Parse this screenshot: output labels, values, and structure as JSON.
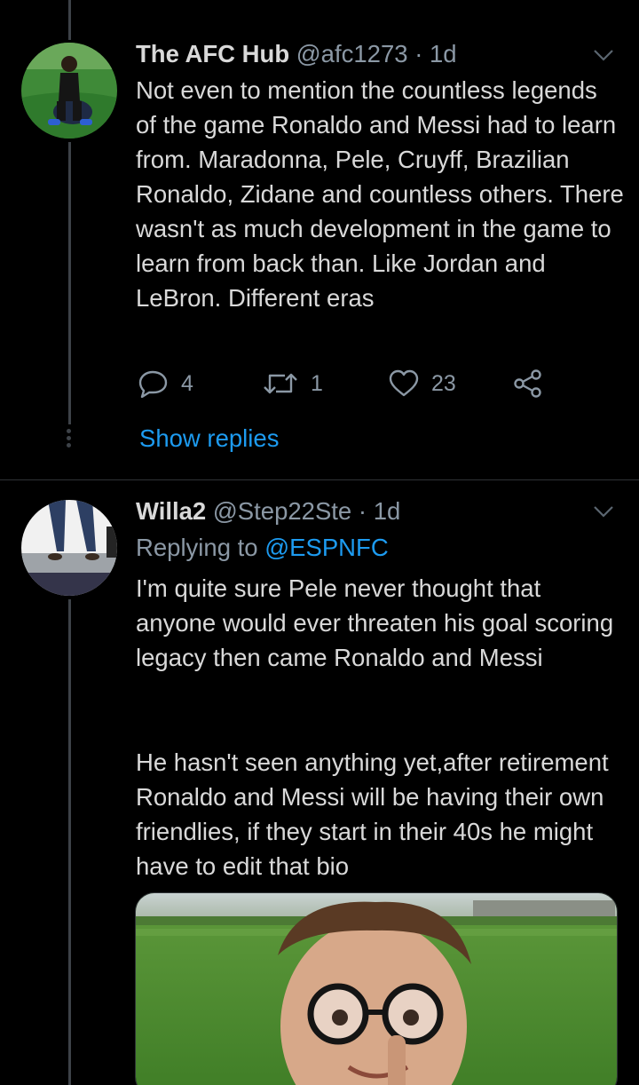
{
  "tweets": [
    {
      "name": "The AFC Hub",
      "handle": "@afc1273",
      "separator": "·",
      "time": "1d",
      "text": "Not even to mention the countless legends of the game Ronaldo and Messi had to learn from. Maradonna, Pele, Cruyff, Brazilian Ronaldo, Zidane and countless others. There wasn't as much development in the game to learn from back than. Like Jordan and LeBron. Different eras",
      "replies": "4",
      "retweets": "1",
      "likes": "23",
      "show_replies": "Show replies"
    },
    {
      "name": "Willa2",
      "handle": "@Step22Ste",
      "separator": "·",
      "time": "1d",
      "replying_prefix": "Replying to ",
      "replying_to": "@ESPNFC",
      "text_p1": "I'm quite sure Pele never thought that anyone would ever threaten his goal scoring legacy then came Ronaldo and Messi",
      "text_p2": "He hasn't seen anything yet,after retirement Ronaldo and Messi will be having their own friendlies, if they start in their 40s he might have to edit that bio"
    }
  ],
  "colors": {
    "background": "#000000",
    "text": "#d9d9d9",
    "secondary": "#8b98a5",
    "link": "#1d9bf0",
    "thread_line": "#3d4248"
  }
}
